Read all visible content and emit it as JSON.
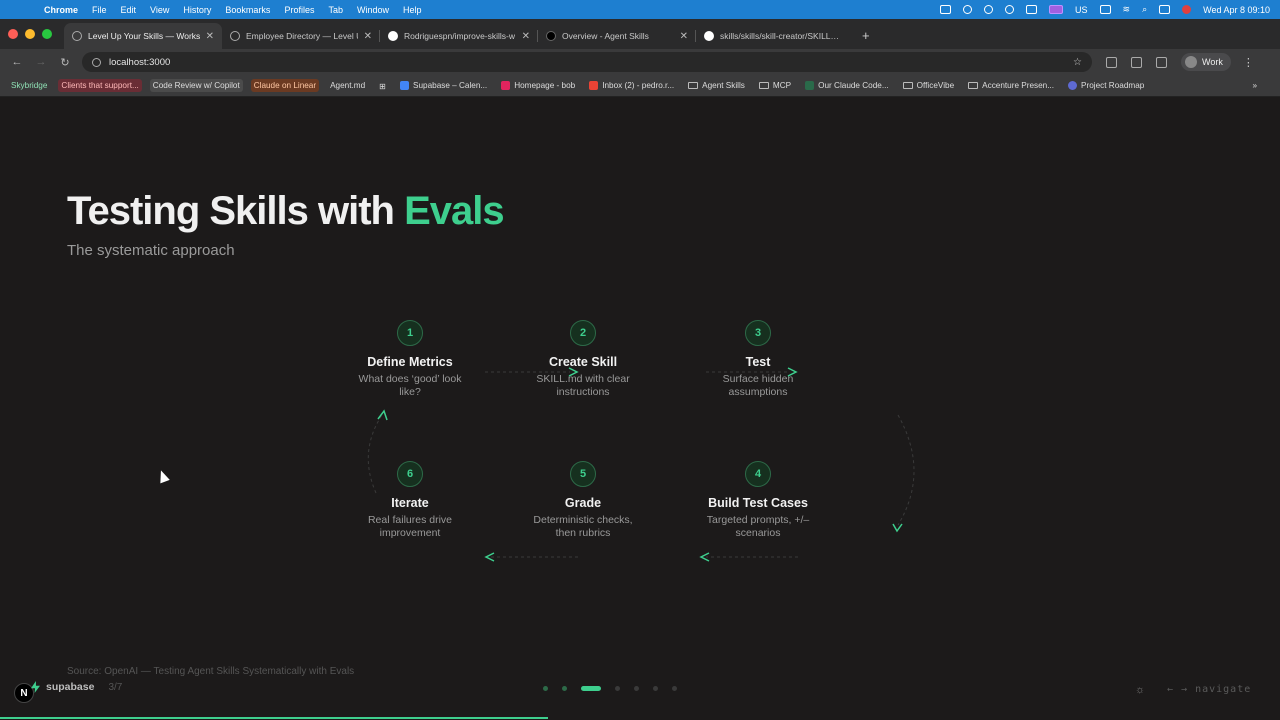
{
  "menubar": {
    "app": "Chrome",
    "items": [
      "File",
      "Edit",
      "View",
      "History",
      "Bookmarks",
      "Profiles",
      "Tab",
      "Window",
      "Help"
    ],
    "input_source": "US",
    "clock": "Wed Apr 8  09:10"
  },
  "tabs": [
    {
      "title": "Level Up Your Skills — Worksh…",
      "icon": "globe-icon"
    },
    {
      "title": "Employee Directory — Level Up",
      "icon": "globe-icon"
    },
    {
      "title": "Rodriguespn/improve-skills-w…",
      "icon": "github-icon"
    },
    {
      "title": "Overview - Agent Skills",
      "icon": "agent-skills-icon"
    },
    {
      "title": "skills/skills/skill-creator/SKILL…",
      "icon": "github-icon"
    }
  ],
  "toolbar": {
    "url": "localhost:3000",
    "profile_label": "Work"
  },
  "bookmarks": [
    {
      "label": "Skybridge",
      "style": "plain-green"
    },
    {
      "label": "Clients that support...",
      "style": "pill-red"
    },
    {
      "label": "Code Review w/ Copilot",
      "style": "pill-gray"
    },
    {
      "label": "Claude on Linear",
      "style": "pill-orange"
    },
    {
      "label": "Agent.md",
      "style": "plain"
    },
    {
      "label": "Supabase – Calen...",
      "style": "calendar"
    },
    {
      "label": "Homepage - bob",
      "style": "b"
    },
    {
      "label": "Inbox (2) - pedro.r...",
      "style": "mail"
    },
    {
      "label": "Agent Skills",
      "style": "folder"
    },
    {
      "label": "MCP",
      "style": "folder"
    },
    {
      "label": "Our Claude Code...",
      "style": "doc"
    },
    {
      "label": "OfficeVibe",
      "style": "folder"
    },
    {
      "label": "Accenture Presen...",
      "style": "folder"
    },
    {
      "label": "Project Roadmap",
      "style": "linear"
    }
  ],
  "slide": {
    "title_main": "Testing Skills with ",
    "title_accent": "Evals",
    "subtitle": "The systematic approach",
    "steps": [
      {
        "num": "1",
        "name": "Define Metrics",
        "desc": "What does ‘good’ look like?"
      },
      {
        "num": "2",
        "name": "Create Skill",
        "desc": "SKILL.md with clear instructions"
      },
      {
        "num": "3",
        "name": "Test",
        "desc": "Surface hidden assumptions"
      },
      {
        "num": "4",
        "name": "Build Test Cases",
        "desc": "Targeted prompts, +/– scenarios"
      },
      {
        "num": "5",
        "name": "Grade",
        "desc": "Deterministic checks, then rubrics"
      },
      {
        "num": "6",
        "name": "Iterate",
        "desc": "Real failures drive improvement"
      }
    ],
    "source": "Source: OpenAI — Testing Agent Skills Systematically with Evals",
    "brand": "supabase",
    "counter": "3/7",
    "nav_hint": "←  →  navigate",
    "badge": "N",
    "total_slides": 7,
    "current_slide": 3,
    "progress_fraction": 0.428
  },
  "colors": {
    "accent": "#3ecf8e",
    "background": "#1c1a1a",
    "menubar": "#1e7fd0"
  }
}
